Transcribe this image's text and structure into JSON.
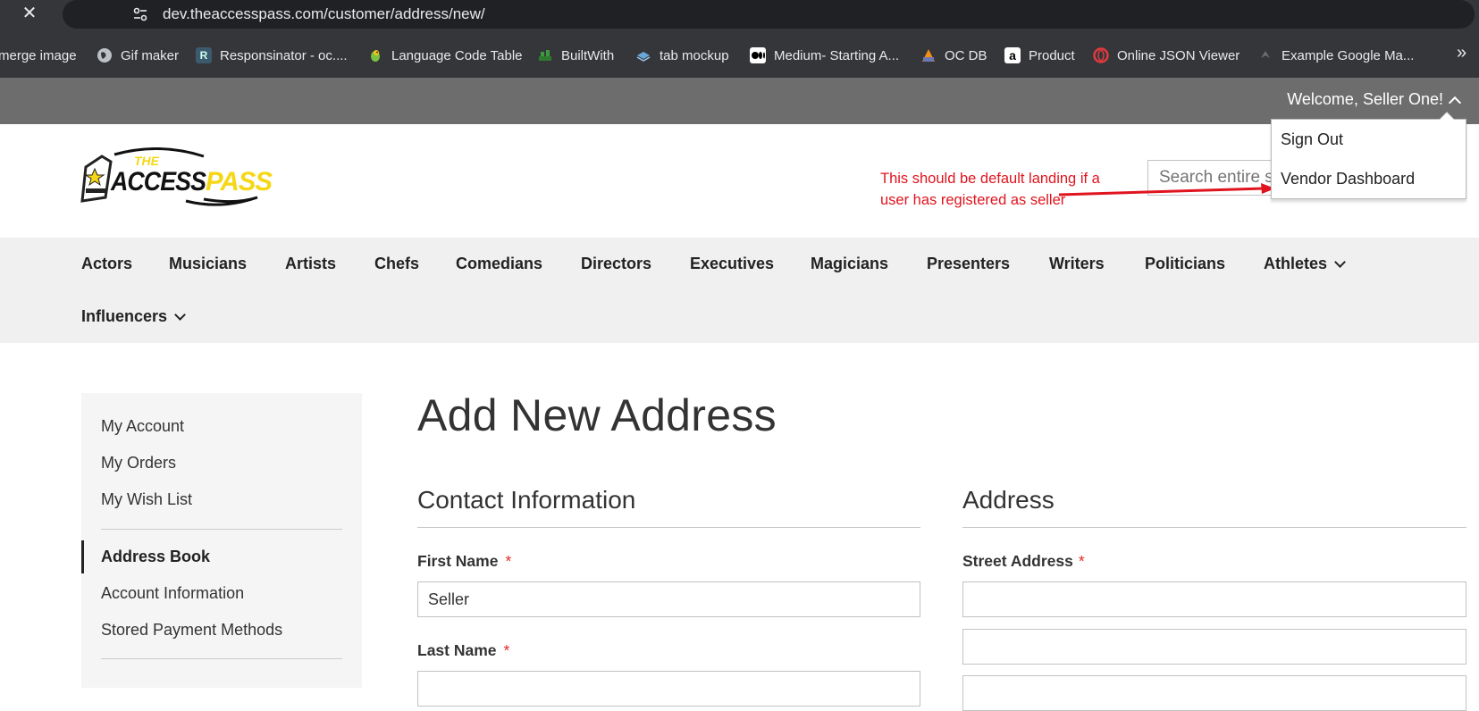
{
  "browser": {
    "url": "dev.theaccesspass.com/customer/address/new/",
    "bookmarks": [
      {
        "label": "merge image",
        "icon": "blank-icon"
      },
      {
        "label": "Gif maker",
        "icon": "globe-icon"
      },
      {
        "label": "Responsinator - oc....",
        "icon": "r-icon"
      },
      {
        "label": "Language Code Table",
        "icon": "parrot-icon"
      },
      {
        "label": "BuiltWith",
        "icon": "builtwith-icon"
      },
      {
        "label": "tab mockup",
        "icon": "layers-icon"
      },
      {
        "label": "Medium- Starting A...",
        "icon": "medium-icon"
      },
      {
        "label": "OC DB",
        "icon": "pma-icon"
      },
      {
        "label": "Product",
        "icon": "amazon-icon"
      },
      {
        "label": "Online JSON Viewer",
        "icon": "json-icon"
      },
      {
        "label": "Example Google Ma...",
        "icon": "maps-icon"
      }
    ],
    "more_bookmarks": "»"
  },
  "header": {
    "welcome": "Welcome, Seller One!",
    "search_placeholder": "Search entire store here...",
    "logo_text_top": "THE",
    "logo_text_main": "ACCESS PASS",
    "dropdown": [
      "Sign Out",
      "Vendor Dashboard"
    ]
  },
  "annotation": {
    "text": "This should be default landing if a user has registered as seller",
    "color": "#e0141e"
  },
  "nav": {
    "items": [
      "Actors",
      "Musicians",
      "Artists",
      "Chefs",
      "Comedians",
      "Directors",
      "Executives",
      "Magicians",
      "Presenters",
      "Writers",
      "Politicians",
      "Athletes",
      "Influencers"
    ]
  },
  "sidebar": {
    "items": [
      "My Account",
      "My Orders",
      "My Wish List",
      "Address Book",
      "Account Information",
      "Stored Payment Methods"
    ],
    "current": "Address Book"
  },
  "main": {
    "title": "Add New Address",
    "contact": {
      "legend": "Contact Information",
      "first_name_label": "First Name",
      "first_name_value": "Seller",
      "last_name_label": "Last Name"
    },
    "address": {
      "legend": "Address",
      "street_label": "Street Address"
    },
    "required_marker": "*"
  },
  "colors": {
    "header_bar": "#6c6d6c",
    "nav_bg": "#f0f0f0",
    "required": "#e02b27",
    "logo_yellow": "#f5d716"
  }
}
